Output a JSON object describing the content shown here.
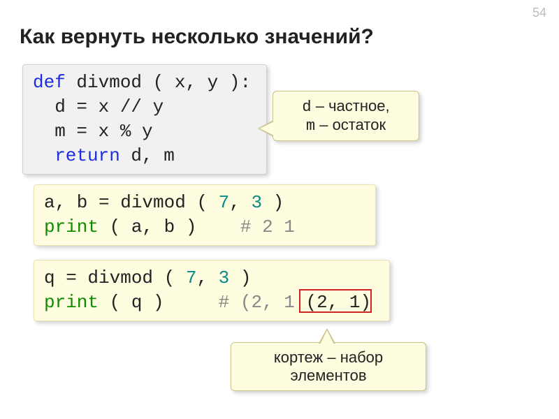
{
  "page_number": "54",
  "title": "Как вернуть несколько значений?",
  "code1": {
    "kw_def": "def",
    "fn": " divmod ( x, y ):",
    "l2": "  d = x // y",
    "l3": "  m = x % y",
    "kw_return": "  return",
    "ret_args": " d, m"
  },
  "callout1": {
    "line1_a": "d",
    "line1_b": " – частное,",
    "line2_a": "m",
    "line2_b": " – остаток"
  },
  "code2": {
    "l1_a": "a, b = divmod ( ",
    "l1_n1": "7",
    "l1_mid": ", ",
    "l1_n2": "3",
    "l1_b": " )",
    "l2_print": "print",
    "l2_args": " ( a, b )    ",
    "l2_comment": "# 2 1"
  },
  "code3": {
    "l1_a": "q = divmod ( ",
    "l1_n1": "7",
    "l1_mid": ", ",
    "l1_n2": "3",
    "l1_b": " )",
    "l2_print": "print",
    "l2_args": " ( q )     ",
    "l2_comment": "# (2, 1",
    "boxed": "(2, 1)"
  },
  "callout2": "кортеж – набор\nэлементов"
}
